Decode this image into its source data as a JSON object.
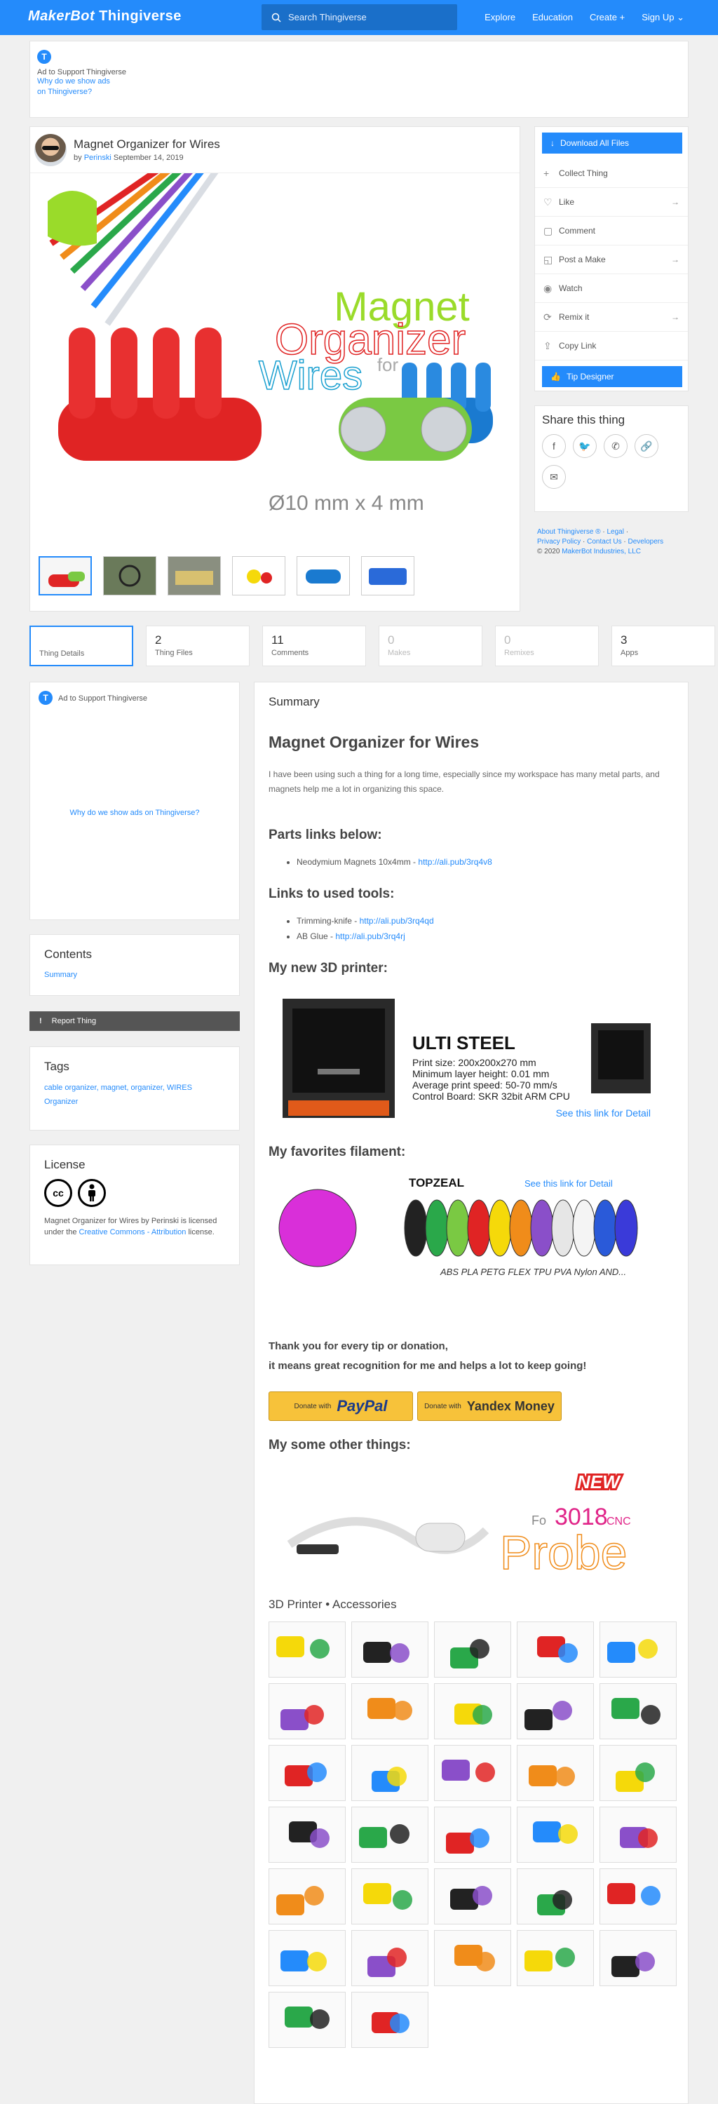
{
  "header": {
    "logo_brand": "MakerBot",
    "logo_product": "Thingiverse",
    "search_placeholder": "Search Thingiverse",
    "nav": [
      "Explore",
      "Education",
      "Create",
      "Sign Up"
    ]
  },
  "top_ad": {
    "badge": "T",
    "label": "Ad to Support Thingiverse",
    "link_line1": "Why do we show ads",
    "link_line2": "on Thingiverse?"
  },
  "thing": {
    "title": "Magnet Organizer for Wires",
    "by": "by",
    "author": "Perinski",
    "date": "September 14, 2019",
    "hero_text": {
      "line1": "Magnet",
      "line2": "Organizer",
      "line3": "Wires",
      "for": "for",
      "dim": "Ø10 mm x 4 mm"
    },
    "thumbnails": 6
  },
  "actions": {
    "download": "Download All Files",
    "items": [
      "Collect Thing",
      "Like",
      "Comment",
      "Post a Make",
      "Watch",
      "Remix it",
      "Copy Link"
    ],
    "tip": "Tip Designer"
  },
  "share": {
    "title": "Share this thing",
    "icons": [
      "facebook-icon",
      "twitter-icon",
      "whatsapp-icon",
      "link-icon",
      "email-icon"
    ]
  },
  "footer_links": {
    "line1": [
      "About Thingiverse ®",
      "Legal"
    ],
    "line2": [
      "Privacy Policy",
      "Contact Us",
      "Developers"
    ],
    "copyright": "© 2020",
    "company": "MakerBot Industries, LLC"
  },
  "tabs": [
    {
      "num": "",
      "label": "Thing Details"
    },
    {
      "num": "2",
      "label": "Thing Files"
    },
    {
      "num": "11",
      "label": "Comments"
    },
    {
      "num": "0",
      "label": "Makes"
    },
    {
      "num": "0",
      "label": "Remixes"
    },
    {
      "num": "3",
      "label": "Apps"
    }
  ],
  "left_ad": {
    "label": "Ad to Support Thingiverse",
    "link": "Why do we show ads on Thingiverse?"
  },
  "contents": {
    "title": "Contents",
    "item": "Summary"
  },
  "report": {
    "label": "Report Thing"
  },
  "tags": {
    "title": "Tags",
    "list": "cable organizer, magnet, organizer, WIRES Organizer"
  },
  "license": {
    "title": "License",
    "text_pre": "Magnet Organizer for Wires by Perinski is licensed under the",
    "link": "Creative Commons - Attribution",
    "text_post": "license."
  },
  "summary": {
    "heading": "Summary",
    "title": "Magnet Organizer for Wires",
    "intro": "I have been using such a thing for a long time, especially since my workspace has many metal parts, and magnets help me a lot in organizing this space.",
    "parts_heading": "Parts links below:",
    "parts": [
      {
        "text": "Neodymium Magnets 10x4mm - ",
        "link": "http://ali.pub/3rq4v8"
      }
    ],
    "tools_heading": "Links to used tools:",
    "tools": [
      {
        "text": "Trimming-knife - ",
        "link": "http://ali.pub/3rq4qd"
      },
      {
        "text": "AB Glue - ",
        "link": "http://ali.pub/3rq4rj"
      }
    ],
    "printer_heading": "My new 3D printer:",
    "printer": {
      "name": "ULTI STEEL",
      "specs": [
        "Print size: 200x200x270 mm",
        "Minimum layer height: 0.01 mm",
        "Average print speed: 50-70 mm/s",
        "Control Board: SKR 32bit ARM CPU"
      ],
      "link": "See this link for Detail"
    },
    "filament_heading": "My favorites filament:",
    "filament": {
      "brand": "TOPZEAL",
      "link": "See this link for Detail",
      "types": "ABS PLA PETG FLEX TPU PVA Nylon AND...",
      "colors": [
        "#d92fd9",
        "#222222",
        "#2aa84a",
        "#7ac943",
        "#e02424",
        "#f5d90a",
        "#f08c1a",
        "#8a4fc9",
        "#e6e6e6",
        "#f4f4f4",
        "#2a5ad9",
        "#3a3ad9"
      ]
    },
    "thanks_line1": "Thank you for every tip or donation,",
    "thanks_line2": "it means great recognition for me and helps a lot to keep going!",
    "donate_with": "Donate with",
    "paypal": "PayPal",
    "yandex": "Yandex Money",
    "other_heading": "My some other things:",
    "probe": {
      "badge": "NEW",
      "model": "3018",
      "suffix": "CNC",
      "word": "Probe",
      "prefix": "Fo"
    },
    "accessories_heading": "3D Printer • Accessories",
    "accessory_count": 32
  },
  "colors": {
    "accent": "#248bfb",
    "page_bg": "#f0f0f0"
  }
}
